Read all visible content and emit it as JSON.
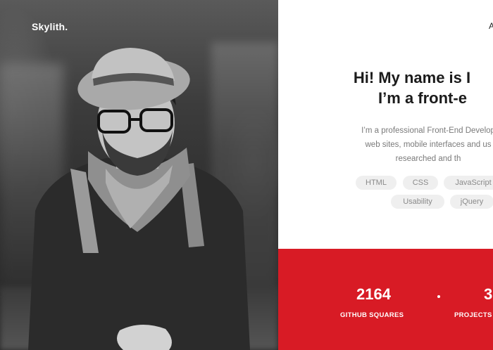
{
  "brand": {
    "logo": "Skylith."
  },
  "nav": {
    "peek": "A"
  },
  "hero": {
    "headline_line1": "Hi! My name is I",
    "headline_line2": "I’m a front-e",
    "intro_line1": "I’m a professional Front-End Develop",
    "intro_line2": "web sites, mobile interfaces and us",
    "intro_line3": "researched and th"
  },
  "skills": [
    "HTML",
    "CSS",
    "JavaScript",
    "Usability",
    "jQuery"
  ],
  "stats": [
    {
      "value": "2164",
      "label": "GITHUB SQUARES"
    },
    {
      "value": "3",
      "label": "PROJECTS"
    }
  ],
  "colors": {
    "accent": "#d81b25",
    "tag_bg": "#efefef",
    "heading": "#1b1b1b"
  },
  "photo": {
    "description_icon": "portrait-photo"
  }
}
